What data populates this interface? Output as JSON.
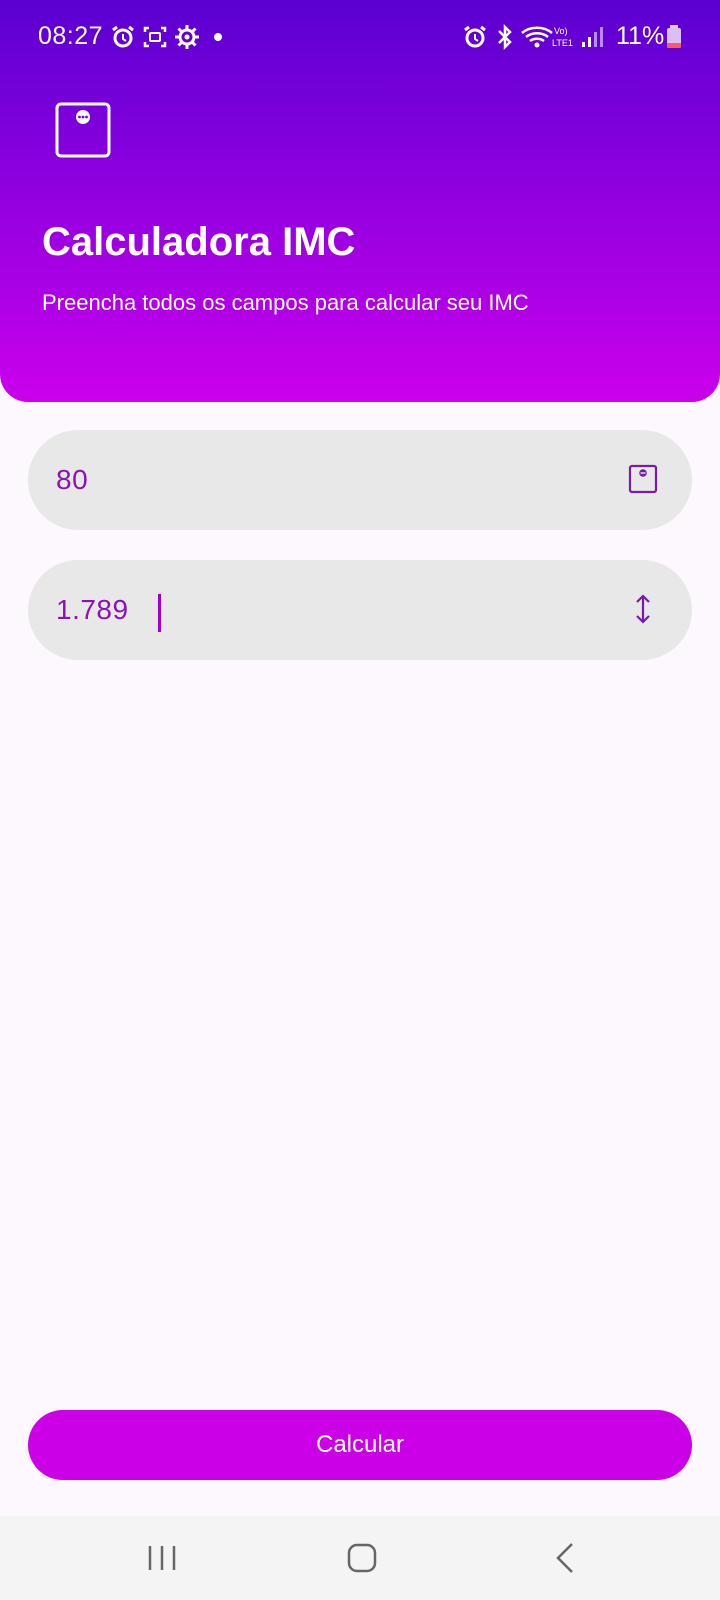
{
  "status_bar": {
    "time": "08:27",
    "battery": "11%"
  },
  "header": {
    "title": "Calculadora IMC",
    "subtitle": "Preencha todos os campos para calcular seu IMC"
  },
  "form": {
    "weight_value": "80",
    "height_value": "1.789"
  },
  "actions": {
    "calculate_label": "Calcular"
  },
  "colors": {
    "gradient_top": "#5a00d1",
    "gradient_bottom": "#cb00ec",
    "accent": "#cc00e6",
    "input_text": "#8a13b5"
  },
  "icons": {
    "header": "scale-icon",
    "weight_field": "scale-icon",
    "height_field": "vertical-arrows-icon"
  }
}
